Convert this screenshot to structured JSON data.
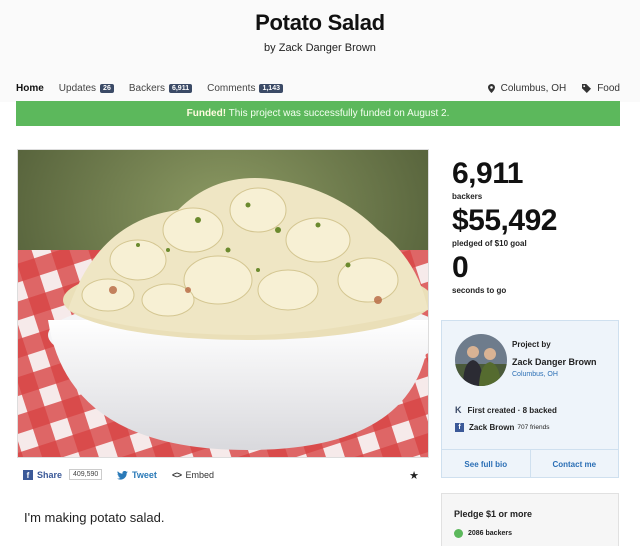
{
  "project": {
    "title": "Potato Salad",
    "byline": "by Zack Danger Brown"
  },
  "nav": {
    "home": "Home",
    "updates": "Updates",
    "updates_count": "26",
    "backers": "Backers",
    "backers_count": "6,911",
    "comments": "Comments",
    "comments_count": "1,143",
    "location": "Columbus, OH",
    "category": "Food",
    "location_icon": "map-pin-icon",
    "category_icon": "tag-icon"
  },
  "banner": {
    "funded": "Funded!",
    "message": "This project was successfully funded on August 2."
  },
  "share": {
    "share_label": "Share",
    "share_count": "409,590",
    "tweet_label": "Tweet",
    "embed_label": "Embed",
    "embed_code": "<>"
  },
  "blurb": "I'm making potato salad.",
  "stats": {
    "backers_value": "6,911",
    "backers_label": "backers",
    "pledged_value": "$55,492",
    "pledged_label": "pledged of $10 goal",
    "seconds_value": "0",
    "seconds_label": "seconds to go"
  },
  "creator": {
    "project_by": "Project by",
    "name": "Zack Danger Brown",
    "location": "Columbus, OH",
    "first_created": "First created · 8 backed",
    "fb_name": "Zack Brown",
    "fb_friends": "707 friends",
    "see_bio": "See full bio",
    "contact": "Contact me"
  },
  "reward": {
    "title": "Pledge $1 or more",
    "backers": "2086 backers"
  },
  "colors": {
    "funded_green": "#5cb85c",
    "link_blue": "#2b6fb5",
    "badge": "#3b4a66"
  }
}
